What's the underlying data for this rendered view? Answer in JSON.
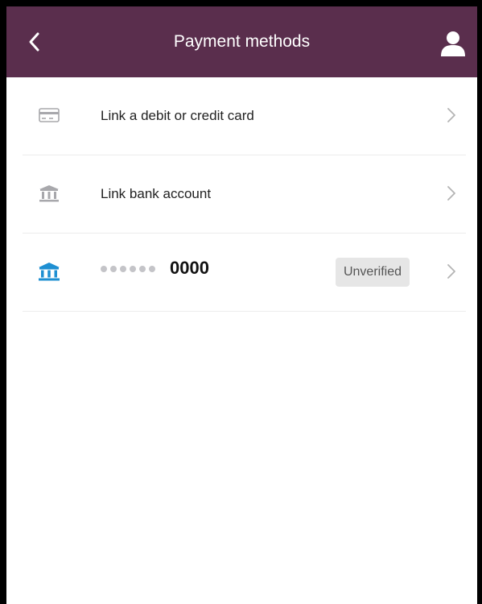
{
  "header": {
    "title": "Payment methods",
    "back_icon": "chevron-left-icon",
    "profile_icon": "user-icon",
    "background_color": "#5a2e4d"
  },
  "rows": [
    {
      "icon": "credit-card-icon",
      "label": "Link a debit or credit card"
    },
    {
      "icon": "bank-icon",
      "label": "Link bank account"
    },
    {
      "icon": "bank-icon",
      "icon_color": "#1e8fd2",
      "masked_last4": "0000",
      "status": "Unverified"
    }
  ]
}
